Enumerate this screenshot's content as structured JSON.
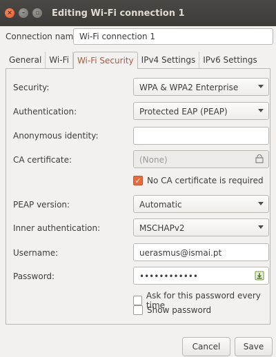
{
  "window": {
    "title": "Editing Wi-Fi connection 1",
    "close_glyph": "×",
    "min_glyph": "–",
    "max_glyph": "▫"
  },
  "connection": {
    "label": "Connection name:",
    "value": "Wi-Fi connection 1"
  },
  "tabs": [
    {
      "label": "General"
    },
    {
      "label": "Wi-Fi"
    },
    {
      "label": "Wi-Fi Security"
    },
    {
      "label": "IPv4 Settings"
    },
    {
      "label": "IPv6 Settings"
    }
  ],
  "active_tab": "Wi-Fi Security",
  "form": {
    "security": {
      "label": "Security:",
      "value": "WPA & WPA2 Enterprise"
    },
    "authentication": {
      "label": "Authentication:",
      "value": "Protected EAP (PEAP)"
    },
    "anonymous_identity": {
      "label": "Anonymous identity:",
      "value": ""
    },
    "ca_certificate": {
      "label": "CA certificate:",
      "value": "(None)",
      "icon": "certificate-icon"
    },
    "no_ca_required": {
      "label": "No CA certificate is required",
      "checked": true
    },
    "peap_version": {
      "label": "PEAP version:",
      "value": "Automatic"
    },
    "inner_authentication": {
      "label": "Inner authentication:",
      "value": "MSCHAPv2"
    },
    "username": {
      "label": "Username:",
      "value": "uerasmus@ismai.pt"
    },
    "password": {
      "label": "Password:",
      "value": "••••••••••••",
      "icon": "password-store-icon"
    },
    "ask_password": {
      "label": "Ask for this password every time",
      "checked": false
    },
    "show_password": {
      "label": "Show password",
      "checked": false
    }
  },
  "buttons": {
    "cancel": "Cancel",
    "save": "Save"
  },
  "colors": {
    "accent": "#e86a3b",
    "active_tab_text": "#b0563b",
    "titlebar": "#3c3b37"
  }
}
